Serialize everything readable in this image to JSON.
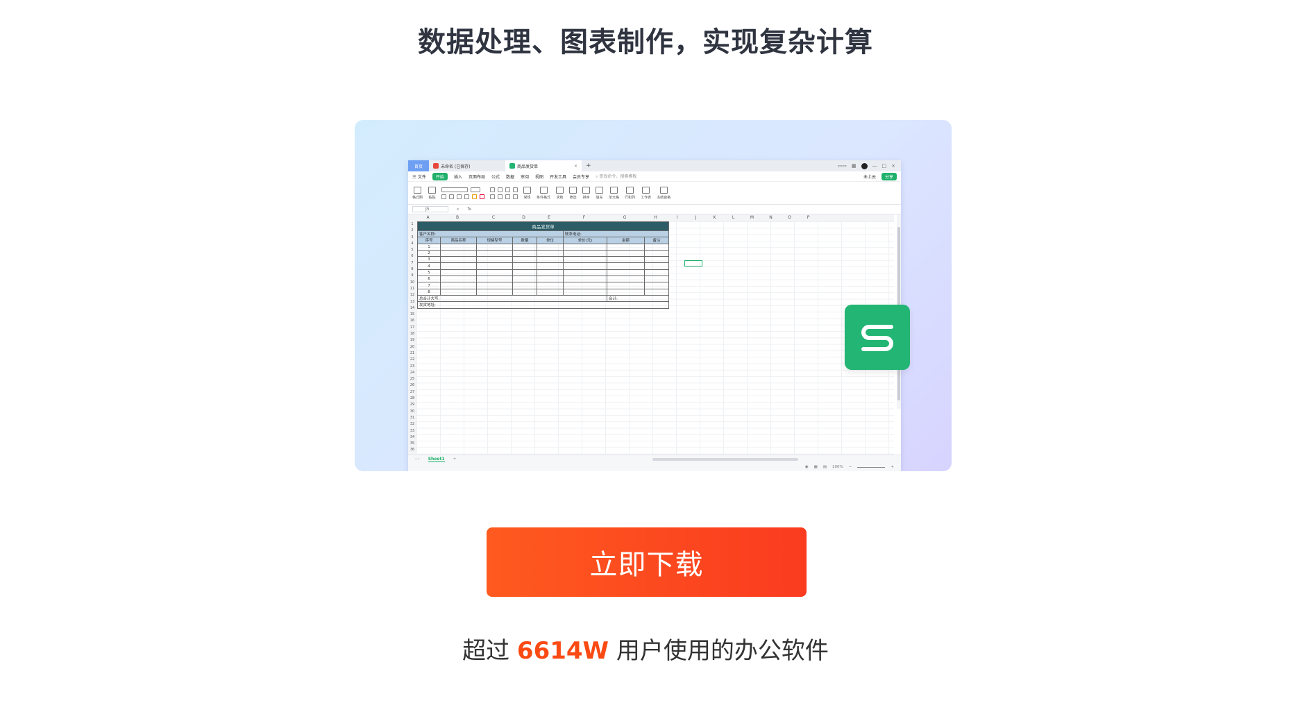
{
  "header": {
    "title": "数据处理、图表制作，实现复杂计算"
  },
  "screenshot": {
    "tabs": {
      "home": "首页",
      "doc1": "未命名 (已保存)",
      "doc2": "商品发货单"
    },
    "menu": [
      "三 文件",
      "开始",
      "插入",
      "页面布局",
      "公式",
      "数据",
      "审阅",
      "视图",
      "开发工具",
      "会员专享"
    ],
    "menu_search": "查找命令、搜索模板",
    "menu_right": {
      "collab": "未上云",
      "share_label": "分享"
    },
    "ribbon": [
      "格式刷",
      "粘贴",
      "常规",
      "条件格式",
      "求和",
      "筛选",
      "排序",
      "填充",
      "单元格",
      "行和列",
      "工作表",
      "冻结窗格"
    ],
    "name_box": "J5",
    "fx": "fx",
    "columns": [
      "A",
      "B",
      "C",
      "D",
      "E",
      "F",
      "G",
      "H",
      "I",
      "J",
      "K",
      "L",
      "M",
      "N",
      "O",
      "P"
    ],
    "rows": [
      "1",
      "2",
      "3",
      "4",
      "5",
      "6",
      "7",
      "8",
      "9",
      "10",
      "11",
      "12",
      "13",
      "14",
      "15",
      "16",
      "17",
      "18",
      "19",
      "20",
      "21",
      "22",
      "23",
      "24",
      "25",
      "26",
      "27",
      "28",
      "29",
      "30",
      "31",
      "32",
      "33",
      "34",
      "35",
      "36"
    ],
    "form": {
      "title": "商品发货单",
      "customer_label": "客户名称:",
      "phone_label": "联系电话:",
      "headers": [
        "序号",
        "商品名称",
        "规格型号",
        "数量",
        "单位",
        "单价(元)",
        "金额",
        "备注"
      ],
      "numbers": [
        "1",
        "2",
        "3",
        "4",
        "5",
        "6",
        "7",
        "8"
      ],
      "total_uppercase": "总合计大写:",
      "total": "合计:",
      "address": "发货地址:"
    },
    "sheet_tab": "Sheet1",
    "zoom": "100%"
  },
  "cta": {
    "download": "立即下载"
  },
  "users": {
    "prefix": "超过 ",
    "count": "6614W",
    "suffix": " 用户使用的办公软件"
  },
  "colors": {
    "accent": "#fa4a14",
    "brand_green": "#22b573"
  }
}
